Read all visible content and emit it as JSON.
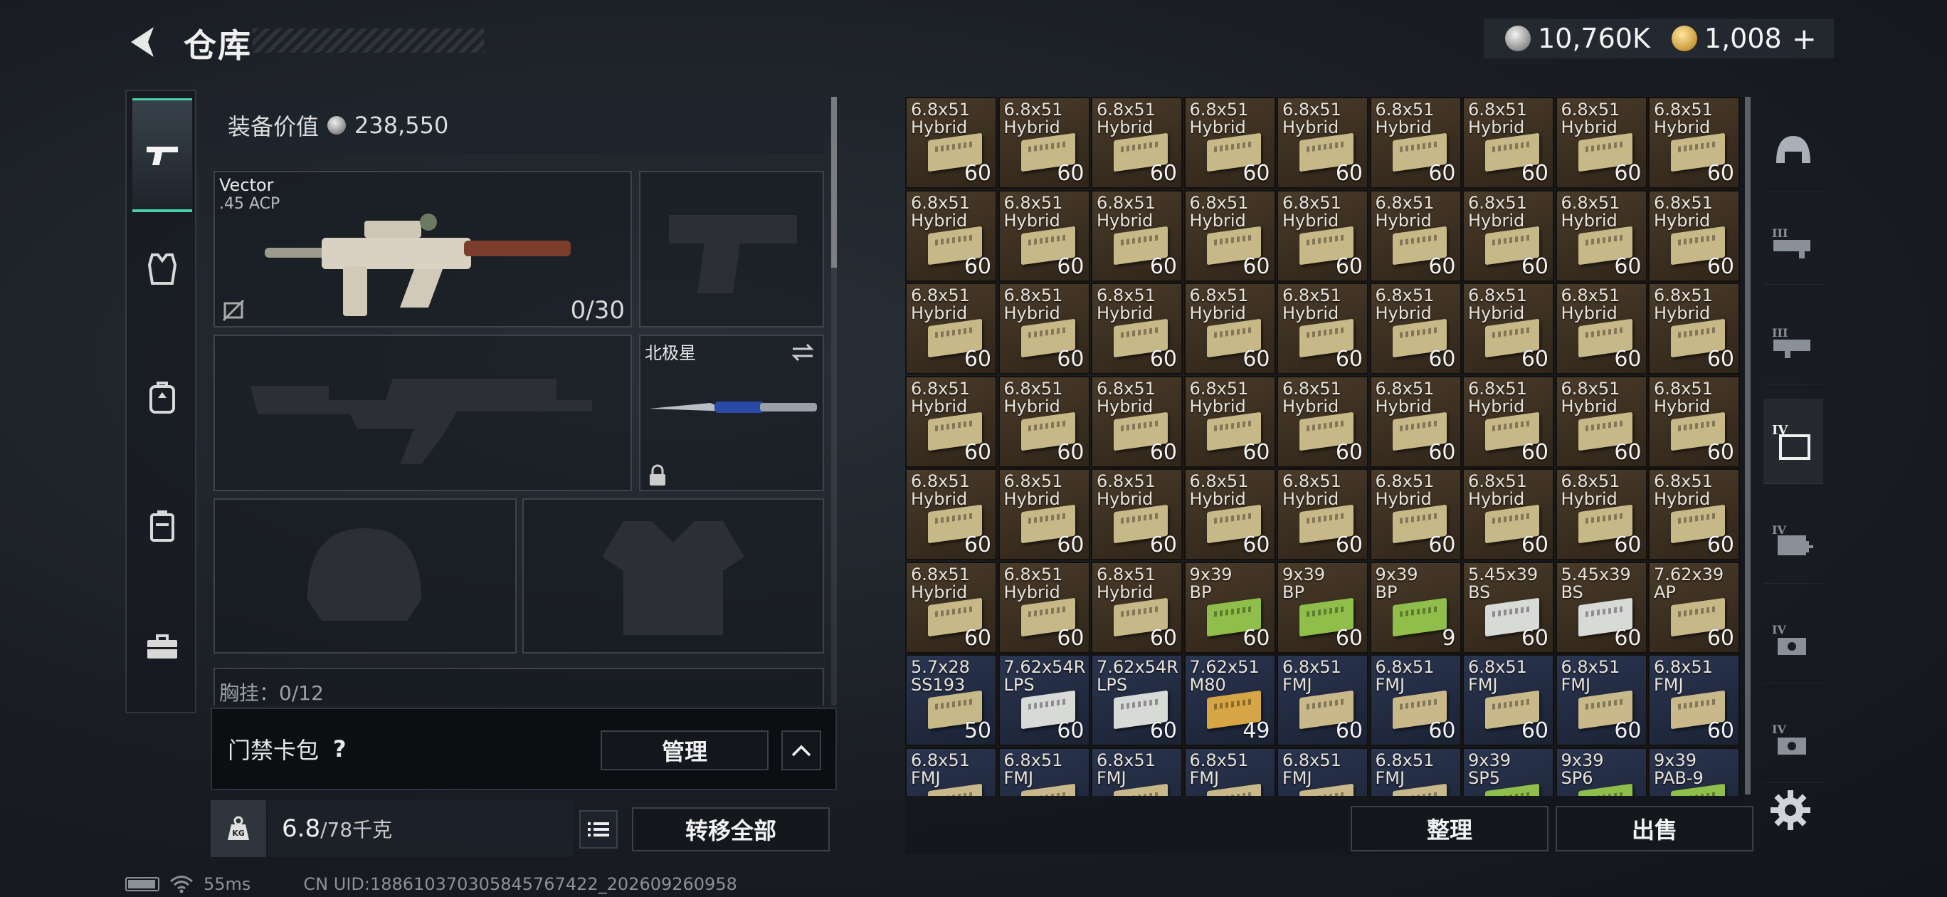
{
  "header": {
    "title": "仓库"
  },
  "currency": {
    "silver": "10,760K",
    "gold": "1,008",
    "add": "+"
  },
  "nav": [
    "pistol-icon",
    "vest-icon",
    "backpack-icon",
    "case-icon",
    "toolbox-icon"
  ],
  "loadout": {
    "value_label": "装备价值",
    "value": "238,550",
    "primary": {
      "name": "Vector",
      "caliber": ".45 ACP",
      "ammo": "0/30"
    },
    "melee": {
      "name": "北极星"
    },
    "partial_row": "胸挂：0/12"
  },
  "keycard": {
    "label": "门禁卡包",
    "help": "?",
    "manage": "管理"
  },
  "weight": {
    "current": "6.8",
    "max": "/78千克",
    "transfer_all": "转移全部"
  },
  "stash_buttons": {
    "organize": "整理",
    "sell": "出售"
  },
  "status": {
    "ping": "55ms",
    "uid": "CN UID:18861037030584576742­2_202609260958"
  },
  "stash": {
    "colors": {
      "brown": "#4a3b2a",
      "blue": "#2a3550",
      "fmj": "#c9b98a",
      "hybrid": "#c7b888",
      "green": "#8fbf4a",
      "white": "#d8dad8",
      "gold": "#d6a545"
    },
    "rows": [
      [
        [
          "6.8x51\nHybrid",
          "60",
          "hybrid",
          "brown"
        ],
        [
          "6.8x51\nHybrid",
          "60",
          "hybrid",
          "brown"
        ],
        [
          "6.8x51\nHybrid",
          "60",
          "hybrid",
          "brown"
        ],
        [
          "6.8x51\nHybrid",
          "60",
          "hybrid",
          "brown"
        ],
        [
          "6.8x51\nHybrid",
          "60",
          "hybrid",
          "brown"
        ],
        [
          "6.8x51\nHybrid",
          "60",
          "hybrid",
          "brown"
        ],
        [
          "6.8x51\nHybrid",
          "60",
          "hybrid",
          "brown"
        ],
        [
          "6.8x51\nHybrid",
          "60",
          "hybrid",
          "brown"
        ],
        [
          "6.8x51\nHybrid",
          "60",
          "hybrid",
          "brown"
        ]
      ],
      [
        [
          "6.8x51\nHybrid",
          "60",
          "hybrid",
          "brown"
        ],
        [
          "6.8x51\nHybrid",
          "60",
          "hybrid",
          "brown"
        ],
        [
          "6.8x51\nHybrid",
          "60",
          "hybrid",
          "brown"
        ],
        [
          "6.8x51\nHybrid",
          "60",
          "hybrid",
          "brown"
        ],
        [
          "6.8x51\nHybrid",
          "60",
          "hybrid",
          "brown"
        ],
        [
          "6.8x51\nHybrid",
          "60",
          "hybrid",
          "brown"
        ],
        [
          "6.8x51\nHybrid",
          "60",
          "hybrid",
          "brown"
        ],
        [
          "6.8x51\nHybrid",
          "60",
          "hybrid",
          "brown"
        ],
        [
          "6.8x51\nHybrid",
          "60",
          "hybrid",
          "brown"
        ]
      ],
      [
        [
          "6.8x51\nHybrid",
          "60",
          "hybrid",
          "brown"
        ],
        [
          "6.8x51\nHybrid",
          "60",
          "hybrid",
          "brown"
        ],
        [
          "6.8x51\nHybrid",
          "60",
          "hybrid",
          "brown"
        ],
        [
          "6.8x51\nHybrid",
          "60",
          "hybrid",
          "brown"
        ],
        [
          "6.8x51\nHybrid",
          "60",
          "hybrid",
          "brown"
        ],
        [
          "6.8x51\nHybrid",
          "60",
          "hybrid",
          "brown"
        ],
        [
          "6.8x51\nHybrid",
          "60",
          "hybrid",
          "brown"
        ],
        [
          "6.8x51\nHybrid",
          "60",
          "hybrid",
          "brown"
        ],
        [
          "6.8x51\nHybrid",
          "60",
          "hybrid",
          "brown"
        ]
      ],
      [
        [
          "6.8x51\nHybrid",
          "60",
          "hybrid",
          "brown"
        ],
        [
          "6.8x51\nHybrid",
          "60",
          "hybrid",
          "brown"
        ],
        [
          "6.8x51\nHybrid",
          "60",
          "hybrid",
          "brown"
        ],
        [
          "6.8x51\nHybrid",
          "60",
          "hybrid",
          "brown"
        ],
        [
          "6.8x51\nHybrid",
          "60",
          "hybrid",
          "brown"
        ],
        [
          "6.8x51\nHybrid",
          "60",
          "hybrid",
          "brown"
        ],
        [
          "6.8x51\nHybrid",
          "60",
          "hybrid",
          "brown"
        ],
        [
          "6.8x51\nHybrid",
          "60",
          "hybrid",
          "brown"
        ],
        [
          "6.8x51\nHybrid",
          "60",
          "hybrid",
          "brown"
        ]
      ],
      [
        [
          "6.8x51\nHybrid",
          "60",
          "hybrid",
          "brown"
        ],
        [
          "6.8x51\nHybrid",
          "60",
          "hybrid",
          "brown"
        ],
        [
          "6.8x51\nHybrid",
          "60",
          "hybrid",
          "brown"
        ],
        [
          "6.8x51\nHybrid",
          "60",
          "hybrid",
          "brown"
        ],
        [
          "6.8x51\nHybrid",
          "60",
          "hybrid",
          "brown"
        ],
        [
          "6.8x51\nHybrid",
          "60",
          "hybrid",
          "brown"
        ],
        [
          "6.8x51\nHybrid",
          "60",
          "hybrid",
          "brown"
        ],
        [
          "6.8x51\nHybrid",
          "60",
          "hybrid",
          "brown"
        ],
        [
          "6.8x51\nHybrid",
          "60",
          "hybrid",
          "brown"
        ]
      ],
      [
        [
          "6.8x51\nHybrid",
          "60",
          "hybrid",
          "brown"
        ],
        [
          "6.8x51\nHybrid",
          "60",
          "hybrid",
          "brown"
        ],
        [
          "6.8x51\nHybrid",
          "60",
          "hybrid",
          "brown"
        ],
        [
          "9x39\nBP",
          "60",
          "green",
          "brown"
        ],
        [
          "9x39\nBP",
          "60",
          "green",
          "brown"
        ],
        [
          "9x39\nBP",
          "9",
          "green",
          "brown"
        ],
        [
          "5.45x39\nBS",
          "60",
          "white",
          "brown"
        ],
        [
          "5.45x39\nBS",
          "60",
          "white",
          "brown"
        ],
        [
          "7.62x39\nAP",
          "60",
          "hybrid",
          "brown"
        ]
      ],
      [
        [
          "5.7x28\nSS193",
          "50",
          "hybrid",
          "blue"
        ],
        [
          "7.62x54R\nLPS",
          "60",
          "white",
          "blue"
        ],
        [
          "7.62x54R\nLPS",
          "60",
          "white",
          "blue"
        ],
        [
          "7.62x51\nM80",
          "49",
          "gold",
          "blue"
        ],
        [
          "6.8x51\nFMJ",
          "60",
          "fmj",
          "blue"
        ],
        [
          "6.8x51\nFMJ",
          "60",
          "fmj",
          "blue"
        ],
        [
          "6.8x51\nFMJ",
          "60",
          "fmj",
          "blue"
        ],
        [
          "6.8x51\nFMJ",
          "60",
          "fmj",
          "blue"
        ],
        [
          "6.8x51\nFMJ",
          "60",
          "fmj",
          "blue"
        ]
      ],
      [
        [
          "6.8x51\nFMJ",
          "",
          "fmj",
          "blue"
        ],
        [
          "6.8x51\nFMJ",
          "",
          "fmj",
          "blue"
        ],
        [
          "6.8x51\nFMJ",
          "",
          "fmj",
          "blue"
        ],
        [
          "6.8x51\nFMJ",
          "",
          "fmj",
          "blue"
        ],
        [
          "6.8x51\nFMJ",
          "",
          "fmj",
          "blue"
        ],
        [
          "6.8x51\nFMJ",
          "",
          "fmj",
          "blue"
        ],
        [
          "9x39\nSP5",
          "",
          "green",
          "blue"
        ],
        [
          "9x39\nSP6",
          "",
          "green",
          "blue"
        ],
        [
          "9x39\nPAB-9",
          "",
          "green",
          "blue"
        ]
      ]
    ]
  },
  "filters": [
    "helmet-filter-icon",
    "rig-iii-icon",
    "rig-iii-alt-icon",
    "case-iv-icon",
    "medkit-iv-icon",
    "toolkit-iv-icon",
    "toolkit-iv-alt-icon"
  ]
}
